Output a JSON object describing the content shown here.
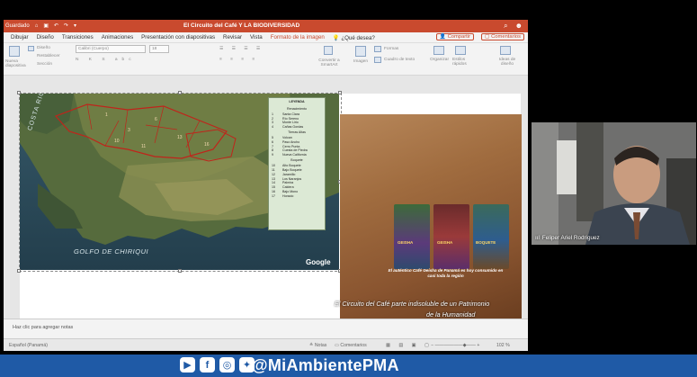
{
  "window": {
    "title": "El Circuito del Café Y LA BIODIVERSIDAD",
    "autosave": "Guardado",
    "theme_color": "#c94a2e"
  },
  "menu": {
    "items": [
      "Dibujar",
      "Diseño",
      "Transiciones",
      "Animaciones",
      "Presentación con diapositivas",
      "Revisar",
      "Vista",
      "Formato de la imagen",
      "¿Qué desea?"
    ],
    "active_index": 7,
    "share": "Compartir",
    "comments": "Comentarios"
  },
  "ribbon": {
    "new_slide": "Nueva diapositiva",
    "layout": "Diseño",
    "reset": "Restablecer",
    "section": "Sección",
    "font_name": "Calibri (Cuerpo)",
    "font_size": "18",
    "convert_smartart": "Convertir a SmartArt",
    "image": "Imagen",
    "shapes": "Formas",
    "text_box": "Cuadro de texto",
    "organize": "Organizar",
    "quick_styles": "Estilos rápidos",
    "design_ideas": "Ideas de diseño"
  },
  "slide": {
    "legend": {
      "title": "LEYENDA",
      "groups": [
        {
          "category": "Renacimiento",
          "rows": [
            [
              "1",
              "Santa Clara"
            ],
            [
              "2",
              "Río Sereno"
            ],
            [
              "3",
              "Monte Lirio"
            ],
            [
              "4",
              "Cañas Gordas"
            ]
          ]
        },
        {
          "category": "Tierras Altas",
          "rows": [
            [
              "5",
              "Volcan"
            ],
            [
              "6",
              "Paso Ancho"
            ],
            [
              "7",
              "Cerro Punta"
            ],
            [
              "8",
              "Cuesta de Piedra"
            ],
            [
              "9",
              "Nueva California"
            ]
          ]
        },
        {
          "category": "Boquete",
          "rows": [
            [
              "10",
              "Alto Boquete"
            ],
            [
              "11",
              "Bajo Boquete"
            ],
            [
              "12",
              "Jaramillo"
            ],
            [
              "13",
              "Los Naranjos"
            ],
            [
              "14",
              "Palmira"
            ],
            [
              "15",
              "Caldera"
            ],
            [
              "16",
              "Bajo Mono"
            ],
            [
              "17",
              "Horacio"
            ]
          ]
        }
      ]
    },
    "map_labels": {
      "gulf": "GOLFO DE CHIRIQUI",
      "country": "COSTA RICA",
      "watermark": "Google"
    },
    "photo_caption": "El auténtico Café Geisha de Panamá es hoy consumido en casi toda la región",
    "bag_labels": [
      "GEISHA",
      "GEISHA",
      "BOQUETE"
    ],
    "main_caption_line1": "El Circuito del Café parte indisoluble de un Patrimonio",
    "main_caption_line2": "de la Humanidad"
  },
  "notes": {
    "placeholder": "Haz clic para agregar notas"
  },
  "status": {
    "language": "Español (Panamá)",
    "notes_btn": "Notas",
    "comments_btn": "Comentarios",
    "zoom": "102 %"
  },
  "video": {
    "participant": "Feliper Ariel Rodriguez"
  },
  "banner": {
    "handle": "@MiAmbientePMA",
    "bg": "#1f5aa6"
  }
}
